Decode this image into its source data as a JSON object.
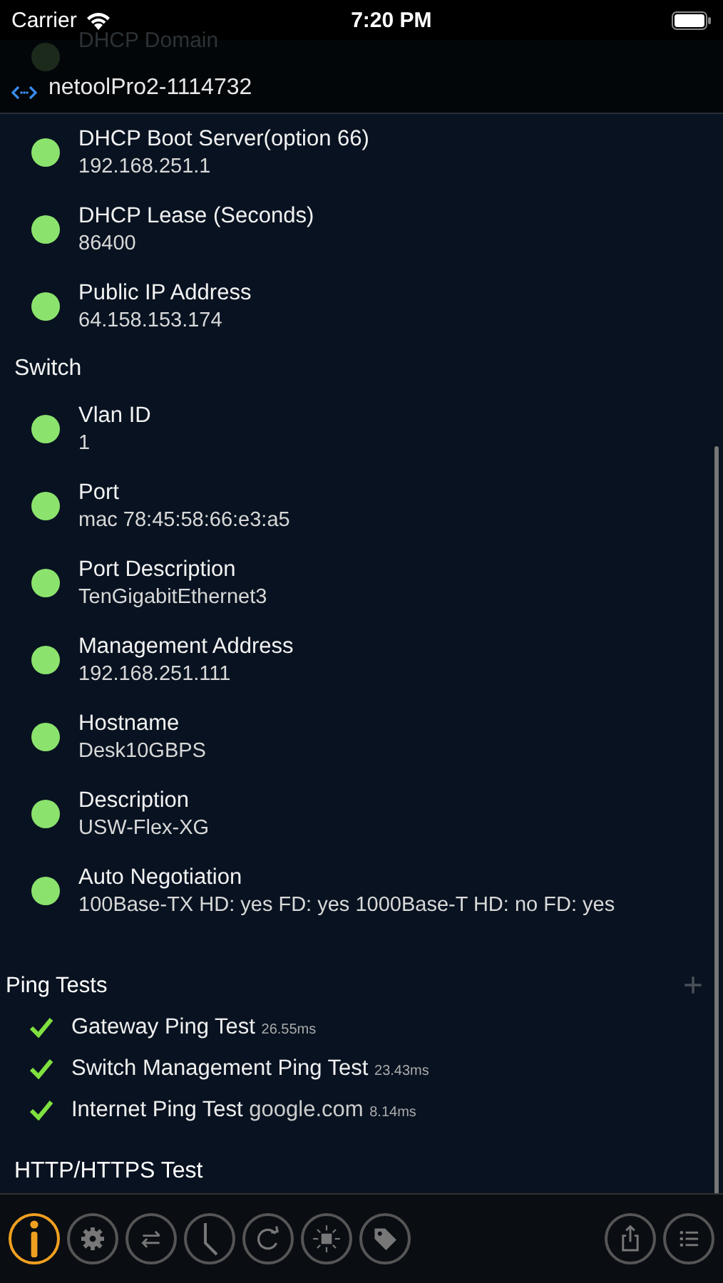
{
  "status_bar": {
    "carrier": "Carrier",
    "time": "7:20 PM"
  },
  "nav": {
    "title": "netoolPro2-1114732",
    "behind": "DHCP Domain"
  },
  "top_items": [
    {
      "label": "DHCP Boot Server(option 66)",
      "value": "192.168.251.1",
      "color": "#8be36d"
    },
    {
      "label": "DHCP Lease (Seconds)",
      "value": "86400",
      "color": "#8be36d"
    },
    {
      "label": "Public IP Address",
      "value": "64.158.153.174",
      "color": "#8be36d"
    }
  ],
  "switch": {
    "title": "Switch",
    "items": [
      {
        "label": "Vlan ID",
        "value": "1",
        "color": "#8be36d"
      },
      {
        "label": "Port",
        "value": "mac 78:45:58:66:e3:a5",
        "color": "#8be36d"
      },
      {
        "label": "Port Description",
        "value": "TenGigabitEthernet3",
        "color": "#8be36d"
      },
      {
        "label": "Management Address",
        "value": "192.168.251.111",
        "color": "#8be36d"
      },
      {
        "label": "Hostname",
        "value": "Desk10GBPS",
        "color": "#8be36d"
      },
      {
        "label": "Description",
        "value": "USW-Flex-XG",
        "color": "#8be36d"
      },
      {
        "label": "Auto Negotiation",
        "value": "100Base-TX HD: yes FD: yes 1000Base-T HD: no FD: yes",
        "color": "#8be36d"
      }
    ]
  },
  "ping_tests": {
    "title": "Ping Tests",
    "add": "+",
    "items": [
      {
        "name": "Gateway Ping Test",
        "time": "26.55ms",
        "passed": true
      },
      {
        "name": "Switch Management Ping Test",
        "time": "23.43ms",
        "passed": true
      },
      {
        "name": "Internet Ping Test",
        "target": "google.com",
        "time": "8.14ms",
        "passed": true
      }
    ]
  },
  "http_test": {
    "title": "HTTP/HTTPS Test"
  },
  "toolbar": [
    {
      "kind": "info",
      "selected": true
    },
    {
      "kind": "gear",
      "selected": false
    },
    {
      "kind": "swap",
      "selected": false
    },
    {
      "kind": "clock",
      "selected": false
    },
    {
      "kind": "refresh",
      "selected": false
    },
    {
      "kind": "light",
      "selected": false
    },
    {
      "kind": "tag",
      "selected": false
    },
    {
      "kind": "share",
      "selected": false
    },
    {
      "kind": "list",
      "selected": false
    }
  ]
}
